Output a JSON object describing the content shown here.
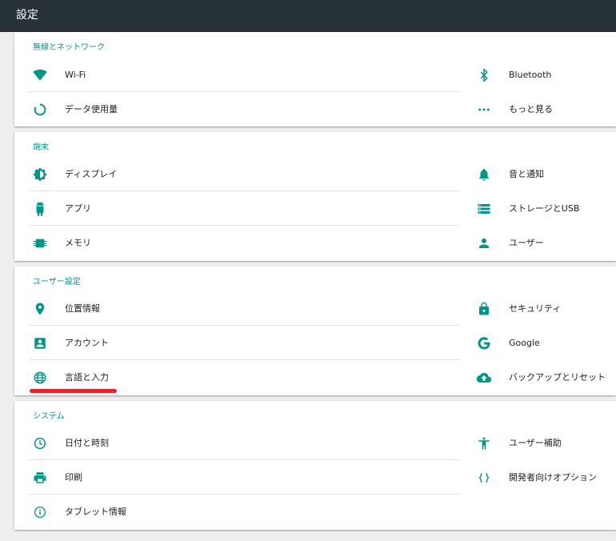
{
  "app": {
    "title": "設定"
  },
  "sections": {
    "wireless": {
      "title": "無線とネットワーク",
      "wifi": "Wi-Fi",
      "bluetooth": "Bluetooth",
      "data_usage": "データ使用量",
      "more": "もっと見る"
    },
    "device": {
      "title": "端末",
      "display": "ディスプレイ",
      "sound": "音と通知",
      "apps": "アプリ",
      "storage": "ストレージとUSB",
      "memory": "メモリ",
      "users": "ユーザー"
    },
    "personal": {
      "title": "ユーザー設定",
      "location": "位置情報",
      "security": "セキュリティ",
      "accounts": "アカウント",
      "google": "Google",
      "language": "言語と入力",
      "backup": "バックアップとリセット"
    },
    "system": {
      "title": "システム",
      "datetime": "日付と時刻",
      "accessibility": "ユーザー補助",
      "printing": "印刷",
      "developer": "開発者向けオプション",
      "about": "タブレット情報"
    }
  },
  "colors": {
    "accent": "#009688",
    "appbar": "#263238",
    "highlight": "#e8232a"
  }
}
